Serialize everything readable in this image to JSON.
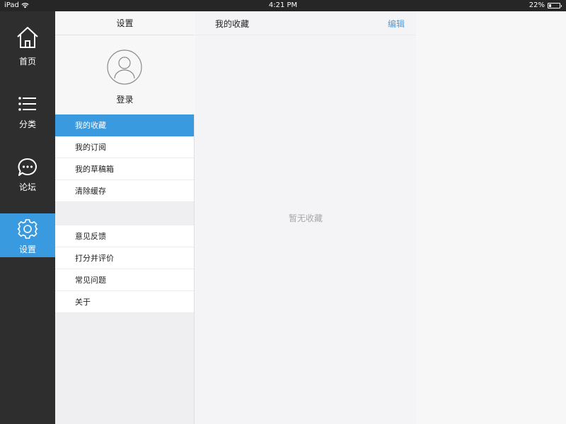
{
  "status_bar": {
    "device": "iPad",
    "time": "4:21 PM",
    "battery": "22%",
    "battery_level": 0.22
  },
  "nav": {
    "items": [
      {
        "label": "首页",
        "icon": "home-icon"
      },
      {
        "label": "分类",
        "icon": "list-icon"
      },
      {
        "label": "论坛",
        "icon": "chat-bubble-icon"
      },
      {
        "label": "设置",
        "icon": "gear-icon",
        "active": true
      }
    ]
  },
  "settings": {
    "title": "设置",
    "login_label": "登录",
    "menu_group1": [
      {
        "label": "我的收藏",
        "active": true
      },
      {
        "label": "我的订阅"
      },
      {
        "label": "我的草稿箱"
      },
      {
        "label": "清除缓存"
      }
    ],
    "menu_group2": [
      {
        "label": "意见反馈"
      },
      {
        "label": "打分并评价"
      },
      {
        "label": "常见问题"
      },
      {
        "label": "关于"
      }
    ]
  },
  "content": {
    "title": "我的收藏",
    "edit_label": "编辑",
    "empty_text": "暂无收藏"
  },
  "colors": {
    "accent": "#3a9ae0",
    "rail_bg": "#2e2e2e",
    "edit_link": "#4a9ee2"
  }
}
